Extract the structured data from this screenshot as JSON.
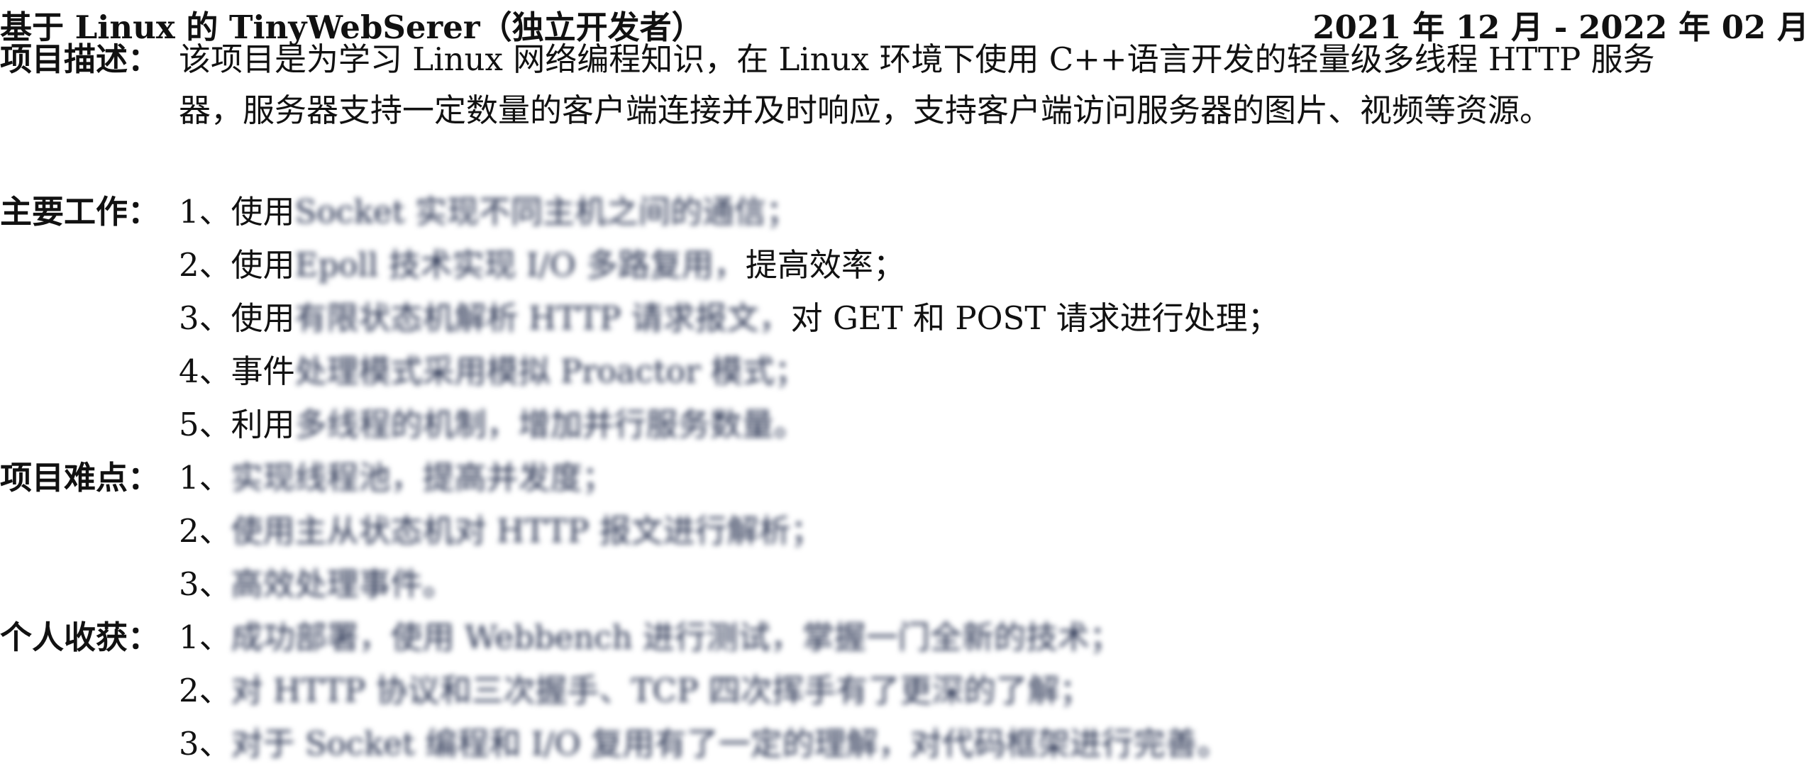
{
  "header": {
    "title": "基于 Linux 的 TinyWebSerer（独立开发者）",
    "date_range": "2021 年 12 月 - 2022 年 02 月"
  },
  "description": {
    "label": "项目描述：",
    "lines": [
      "该项目是为学习 Linux 网络编程知识，在 Linux 环境下使用 C++语言开发的轻量级多线程 HTTP 服务",
      "器，服务器支持一定数量的客户端连接并及时响应，支持客户端访问服务器的图片、视频等资源。"
    ]
  },
  "main_work": {
    "label": "主要工作：",
    "items": [
      {
        "prefix": "1、使用",
        "blurred": "Socket 实现不同主机之间的通信；",
        "suffix": ""
      },
      {
        "prefix": "2、使用",
        "blurred": "Epoll 技术实现 I/O 多路复用，",
        "suffix": "提高效率；"
      },
      {
        "prefix": "3、使用",
        "blurred": "有限状态机解析 HTTP 请求报文，",
        "suffix": "对 GET 和 POST 请求进行处理；"
      },
      {
        "prefix": "4、事件",
        "blurred": "处理模式采用模拟 Proactor 模式；",
        "suffix": ""
      },
      {
        "prefix": "5、利用",
        "blurred": "多线程的机制，增加并行服务数量。",
        "suffix": ""
      }
    ]
  },
  "difficulties": {
    "label": "项目难点：",
    "items": [
      {
        "prefix": "1、",
        "blurred": "实现线程池，提高并发度；",
        "suffix": ""
      },
      {
        "prefix": "2、",
        "blurred": "使用主从状态机对 HTTP 报文进行解析；",
        "suffix": ""
      },
      {
        "prefix": "3、",
        "blurred": "高效处理事件。",
        "suffix": ""
      }
    ]
  },
  "gains": {
    "label": "个人收获：",
    "items": [
      {
        "prefix": "1、",
        "blurred": "成功部署，使用 Webbench 进行测试，掌握一门全新的技术；",
        "suffix": ""
      },
      {
        "prefix": "2、",
        "blurred": "对 HTTP 协议和三次握手、TCP 四次挥手有了更深的了解；",
        "suffix": ""
      },
      {
        "prefix": "3、",
        "blurred": "对于 Socket 编程和 I/O 复用有了一定的理解，对代码框架进行完善。",
        "suffix": ""
      }
    ]
  }
}
